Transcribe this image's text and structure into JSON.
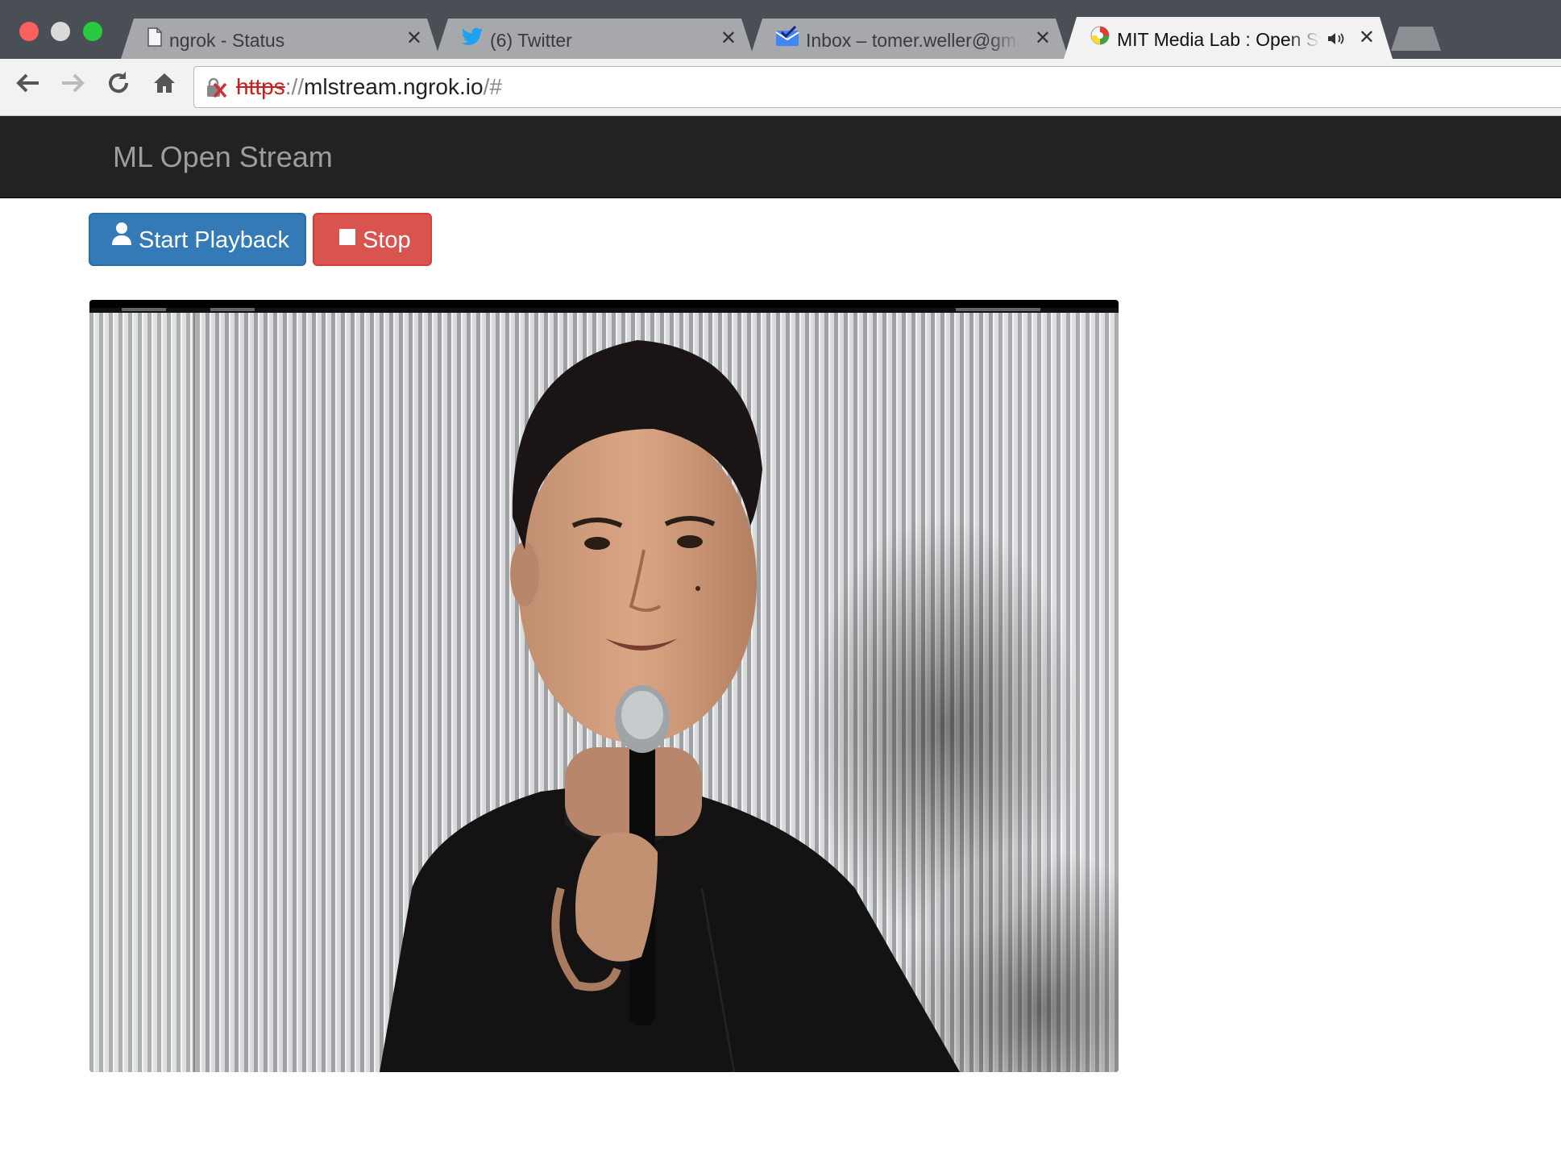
{
  "browser": {
    "tabs": [
      {
        "title": "ngrok - Status",
        "favicon": "document-icon"
      },
      {
        "title": "(6) Twitter",
        "favicon": "twitter-bird-icon"
      },
      {
        "title": "Inbox – tomer.weller@gmail.com",
        "favicon": "inbox-check-icon"
      },
      {
        "title": "MIT Media Lab : Open Stream",
        "favicon": "media-lab-icon",
        "audio": "speaker-icon"
      }
    ],
    "address_bar": {
      "scheme": "https",
      "separator": "://",
      "host": "mlstream.ngrok.io",
      "fragment": "/#",
      "security": "insecure-lock-icon"
    }
  },
  "page": {
    "brand": "ML Open Stream",
    "buttons": {
      "start_label": "Start Playback",
      "stop_label": "Stop"
    }
  },
  "colors": {
    "navbar": "#222222",
    "primary": "#337ab7",
    "danger": "#d9534f"
  }
}
